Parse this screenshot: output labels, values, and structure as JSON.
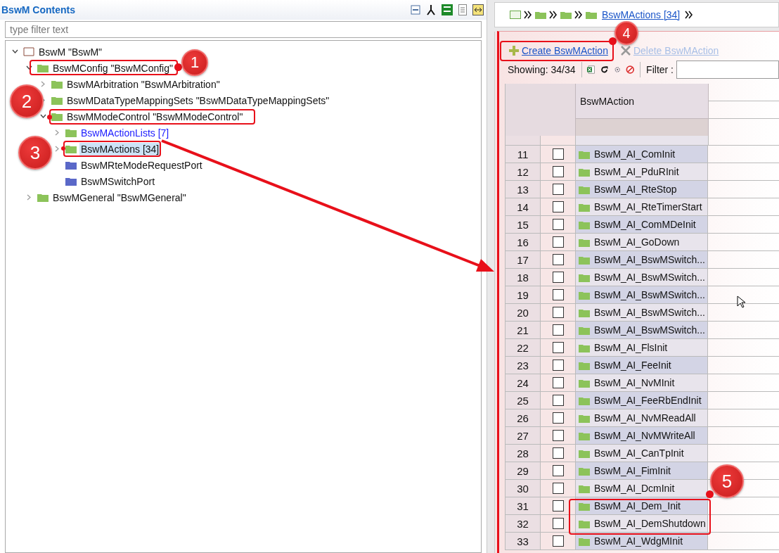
{
  "left_panel": {
    "title": "BswM Contents",
    "filter": {
      "placeholder": "type filter text"
    },
    "tree": [
      {
        "label": "BswM \"BswM\"",
        "kind": "module",
        "expanded": true,
        "selected": false,
        "children": [
          {
            "label": "BswMConfig \"BswMConfig\"",
            "kind": "folder",
            "color": "#8cc35a",
            "expanded": true,
            "selected": false,
            "children": [
              {
                "label": "BswMArbitration \"BswMArbitration\"",
                "kind": "folder",
                "color": "#8cc35a",
                "expanded": false,
                "selected": false
              },
              {
                "label": "BswMDataTypeMappingSets \"BswMDataTypeMappingSets\"",
                "kind": "folder",
                "color": "#8cc35a",
                "expanded": false,
                "selected": false
              },
              {
                "label": "BswMModeControl \"BswMModeControl\"",
                "kind": "folder",
                "color": "#8cc35a",
                "expanded": true,
                "selected": false,
                "children": [
                  {
                    "label": "BswMActionLists [7]",
                    "kind": "link-folder",
                    "color": "#8cc35a",
                    "expanded": false,
                    "selected": false
                  },
                  {
                    "label": "BswMActions [34]",
                    "kind": "folder",
                    "color": "#8cc35a",
                    "expanded": false,
                    "selected": true
                  },
                  {
                    "label": "BswMRteModeRequestPort",
                    "kind": "folder",
                    "color": "#5a68c8",
                    "selected": false
                  },
                  {
                    "label": "BswMSwitchPort",
                    "kind": "folder",
                    "color": "#5a68c8",
                    "selected": false
                  }
                ]
              }
            ]
          },
          {
            "label": "BswMGeneral \"BswMGeneral\"",
            "kind": "folder",
            "color": "#8cc35a",
            "expanded": false,
            "selected": false
          }
        ]
      }
    ]
  },
  "breadcrumb": {
    "current": "BswMActions [34]"
  },
  "editor": {
    "create_action": "Create BswMAction",
    "delete_action": {
      "label": "Delete BswMAction",
      "disabled": true
    },
    "showing": "Showing: 34/34",
    "filter_label": "Filter :",
    "table": {
      "columns": [
        "BswMAction"
      ],
      "rows": [
        {
          "number": "11",
          "checked": false,
          "name": "BswM_AI_ComInit"
        },
        {
          "number": "12",
          "checked": false,
          "name": "BswM_AI_PduRInit"
        },
        {
          "number": "13",
          "checked": false,
          "name": "BswM_AI_RteStop"
        },
        {
          "number": "14",
          "checked": false,
          "name": "BswM_AI_RteTimerStart"
        },
        {
          "number": "15",
          "checked": false,
          "name": "BswM_AI_ComMDeInit"
        },
        {
          "number": "16",
          "checked": false,
          "name": "BswM_AI_GoDown"
        },
        {
          "number": "17",
          "checked": false,
          "name": "BswM_AI_BswMSwitch..."
        },
        {
          "number": "18",
          "checked": false,
          "name": "BswM_AI_BswMSwitch..."
        },
        {
          "number": "19",
          "checked": false,
          "name": "BswM_AI_BswMSwitch..."
        },
        {
          "number": "20",
          "checked": false,
          "name": "BswM_AI_BswMSwitch..."
        },
        {
          "number": "21",
          "checked": false,
          "name": "BswM_AI_BswMSwitch..."
        },
        {
          "number": "22",
          "checked": false,
          "name": "BswM_AI_FlsInit"
        },
        {
          "number": "23",
          "checked": false,
          "name": "BswM_AI_FeeInit"
        },
        {
          "number": "24",
          "checked": false,
          "name": "BswM_AI_NvMInit"
        },
        {
          "number": "25",
          "checked": false,
          "name": "BswM_AI_FeeRbEndInit"
        },
        {
          "number": "26",
          "checked": false,
          "name": "BswM_AI_NvMReadAll"
        },
        {
          "number": "27",
          "checked": false,
          "name": "BswM_AI_NvMWriteAll"
        },
        {
          "number": "28",
          "checked": false,
          "name": "BswM_AI_CanTpInit"
        },
        {
          "number": "29",
          "checked": false,
          "name": "BswM_AI_FimInit"
        },
        {
          "number": "30",
          "checked": false,
          "name": "BswM_AI_DcmInit"
        },
        {
          "number": "31",
          "checked": false,
          "name": "BswM_AI_Dem_Init"
        },
        {
          "number": "32",
          "checked": false,
          "name": "BswM_AI_DemShutdown"
        },
        {
          "number": "33",
          "checked": false,
          "name": "BswM_AI_WdgMInit"
        }
      ]
    }
  },
  "annotations": [
    {
      "number": "1"
    },
    {
      "number": "2"
    },
    {
      "number": "3"
    },
    {
      "number": "4"
    },
    {
      "number": "5"
    }
  ]
}
